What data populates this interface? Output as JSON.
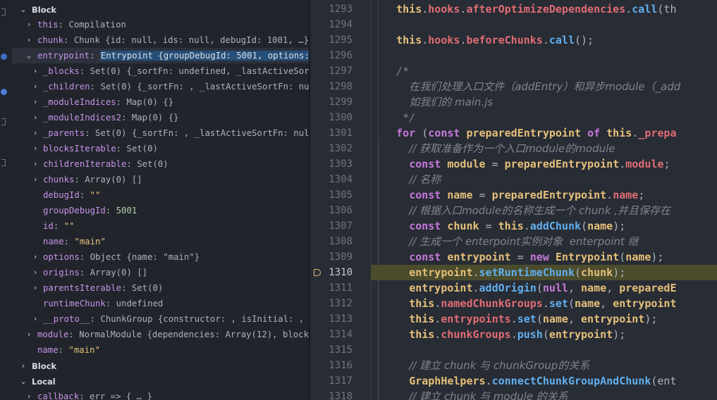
{
  "colors": {
    "background": "#282c34",
    "panel": "#21252b",
    "keyword": "#c678dd",
    "type": "#e5c07b",
    "function": "#61afef",
    "property": "#e06c75",
    "comment": "#7f848e",
    "exec_highlight": "#4b4c2c",
    "selection": "#264f78"
  },
  "variables": {
    "section_block": "Block",
    "this_key": "this",
    "this_val": "Compilation",
    "chunk_key": "chunk",
    "chunk_val": "Chunk {id: null, ids: null, debugId: 1001, …}",
    "entrypoint_key": "entrypoint",
    "entrypoint_val": "Entrypoint {groupDebugId: 5001, options: …",
    "blocks_key": "_blocks",
    "blocks_val": "Set(0) {_sortFn: undefined, _lastActiveSort…",
    "children_key": "_children",
    "children_val": "Set(0) {_sortFn: , _lastActiveSortFn: nul…",
    "moduleIndices_key": "_moduleIndices",
    "moduleIndices_val": "Map(0) {}",
    "moduleIndices2_key": "_moduleIndices2",
    "moduleIndices2_val": "Map(0) {}",
    "parents_key": "_parents",
    "parents_val": "Set(0) {_sortFn: , _lastActiveSortFn: null…",
    "blocksIterable_key": "blocksIterable",
    "blocksIterable_val": "Set(0)",
    "childrenIterable_key": "childrenIterable",
    "childrenIterable_val": "Set(0)",
    "chunks_key": "chunks",
    "chunks_val": "Array(0) []",
    "debugId_key": "debugId",
    "debugId_val": "\"\"",
    "groupDebugId_key": "groupDebugId",
    "groupDebugId_val": "5001",
    "id_key": "id",
    "id_val": "\"\"",
    "name_key": "name",
    "name_val": "\"main\"",
    "options_key": "options",
    "options_val": "Object {name: \"main\"}",
    "origins_key": "origins",
    "origins_val": "Array(0) []",
    "parentsIterable_key": "parentsIterable",
    "parentsIterable_val": "Set(0)",
    "runtimeChunk_key": "runtimeChunk",
    "runtimeChunk_val": "undefined",
    "proto_key": "__proto__",
    "proto_val": "ChunkGroup {constructor: , isInitial: , s…",
    "module_key": "module",
    "module_val": "NormalModule {dependencies: Array(12), blocks…",
    "name2_key": "name",
    "name2_val": "\"main\"",
    "section_block2": "Block",
    "section_local": "Local",
    "callback_key": "callback",
    "callback_val": "err => { … }"
  },
  "editor": {
    "line_numbers": [
      "1293",
      "1294",
      "1295",
      "1296",
      "1297",
      "1298",
      "1299",
      "1300",
      "1301",
      "1302",
      "1303",
      "1304",
      "1305",
      "1306",
      "1307",
      "1308",
      "1309",
      "1310",
      "1311",
      "1312",
      "1313",
      "1314",
      "1315",
      "1316",
      "1317",
      "1318"
    ],
    "current_line": "1310",
    "code": {
      "this": "this",
      "hooks": "hooks",
      "afterOptimizeDependencies": "afterOptimizeDependencies",
      "call": "call",
      "call_tail": "(th",
      "beforeChunks": "beforeChunks",
      "call_close": "();",
      "comment_open": "/*",
      "comment_l1": "在我们处理入口文件（addEntry）和异步module（_add",
      "comment_l2": "如我们的 main.js",
      "comment_close": "*/",
      "for": "for",
      "const": "const",
      "preparedEntrypoint": "preparedEntrypoint",
      "of": "of",
      "prepa": "_prepa",
      "c1302": "// 获取准备作为一个入口module的module",
      "module": "module",
      "c1304": "// 名称",
      "name": "name",
      "c1306": "// 根据入口module的名称生成一个 chunk ,并且保存在",
      "chunk": "chunk",
      "addChunk": "addChunk",
      "c1308": "// 生成一个 enterpoint实例对象  enterpoint 继",
      "entrypoint": "entrypoint",
      "new": "new",
      "Entrypoint": "Entrypoint",
      "setRuntimeChunk": "setRuntimeChunk",
      "addOrigin": "addOrigin",
      "null": "null",
      "prepared_tail": "preparedE",
      "namedChunkGroups": "namedChunkGroups",
      "set": "set",
      "entrypoint_tail": "entrypoint",
      "entrypoints": "entrypoints",
      "chunkGroups": "chunkGroups",
      "push": "push",
      "c1316": "// 建立 chunk 与 chunkGroup的关系",
      "GraphHelpers": "GraphHelpers",
      "connectChunkGroupAndChunk": "connectChunkGroupAndChunk",
      "ent_tail": "(ent",
      "c1318": "// 建立 chunk 与 module 的关系"
    }
  }
}
